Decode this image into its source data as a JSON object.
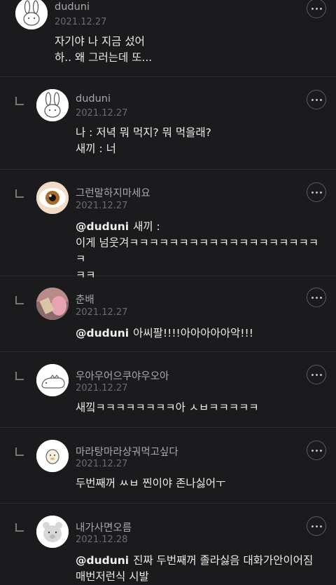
{
  "comments": [
    {
      "name": "duduni",
      "date": "2021.12.27",
      "body": "자기야 나 지금 섰어\n하.. 왜 그러는데 또..."
    },
    {
      "name": "duduni",
      "date": "2021.12.27",
      "body": "나 : 저녁 뭐 먹지? 뭐 먹을래?\n새끼 : 너"
    },
    {
      "name": "그런말하지마세요",
      "date": "2021.12.27",
      "mention": "@duduni",
      "body": "새끼 :\n이게 넘웃겨ㅋㅋㅋㅋㅋㅋㅋㅋㅋㅋㅋㅋㅋㅋㅋㅋㅋㅋㅋㅋ\nㅋㅋ"
    },
    {
      "name": "춘배",
      "date": "2021.12.27",
      "mention": "@duduni",
      "body": "아씨팔!!!!아아아아아악!!!"
    },
    {
      "name": "우아우어으쿠야우오아",
      "date": "2021.12.27",
      "body": "새낔ㅋㅋㅋㅋㅋㅋㅋㅋ아 ㅅㅂㅋㅋㅋㅋㅋ"
    },
    {
      "name": "마라탕마라샹궈먹고싶다",
      "date": "2021.12.27",
      "body": "두번째꺼 ㅆㅂ 찐이야 존나싫어ㅜ"
    },
    {
      "name": "내가사면오름",
      "date": "2021.12.28",
      "mention": "@duduni",
      "body": "진짜 두번째꺼 졸라싫음 대화가안이어짐\n매번저런식 시발"
    }
  ]
}
